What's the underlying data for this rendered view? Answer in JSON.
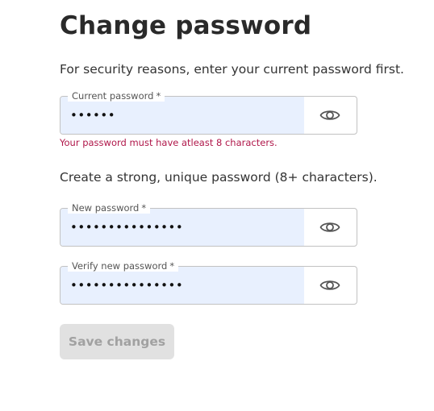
{
  "page": {
    "title": "Change password",
    "intro_current": "For security reasons, enter your current password first.",
    "intro_new": "Create a strong, unique password (8+ characters)."
  },
  "fields": [
    {
      "label": "Current password",
      "required_mark": "*",
      "value": "••••••",
      "error": "Your password must have atleast 8 characters.",
      "toggle_icon": "eye-icon"
    },
    {
      "label": "New password",
      "required_mark": "*",
      "value": "•••••••••••••••",
      "toggle_icon": "eye-icon"
    },
    {
      "label": "Verify new password",
      "required_mark": "*",
      "value": "•••••••••••••••",
      "toggle_icon": "eye-icon"
    }
  ],
  "actions": {
    "save_label": "Save changes",
    "save_enabled": false
  },
  "colors": {
    "error_text": "#b0174a",
    "autofill_background": "#e8f0fe",
    "disabled_button_bg": "#e1e1e1",
    "disabled_button_text": "#a1a1a1"
  }
}
